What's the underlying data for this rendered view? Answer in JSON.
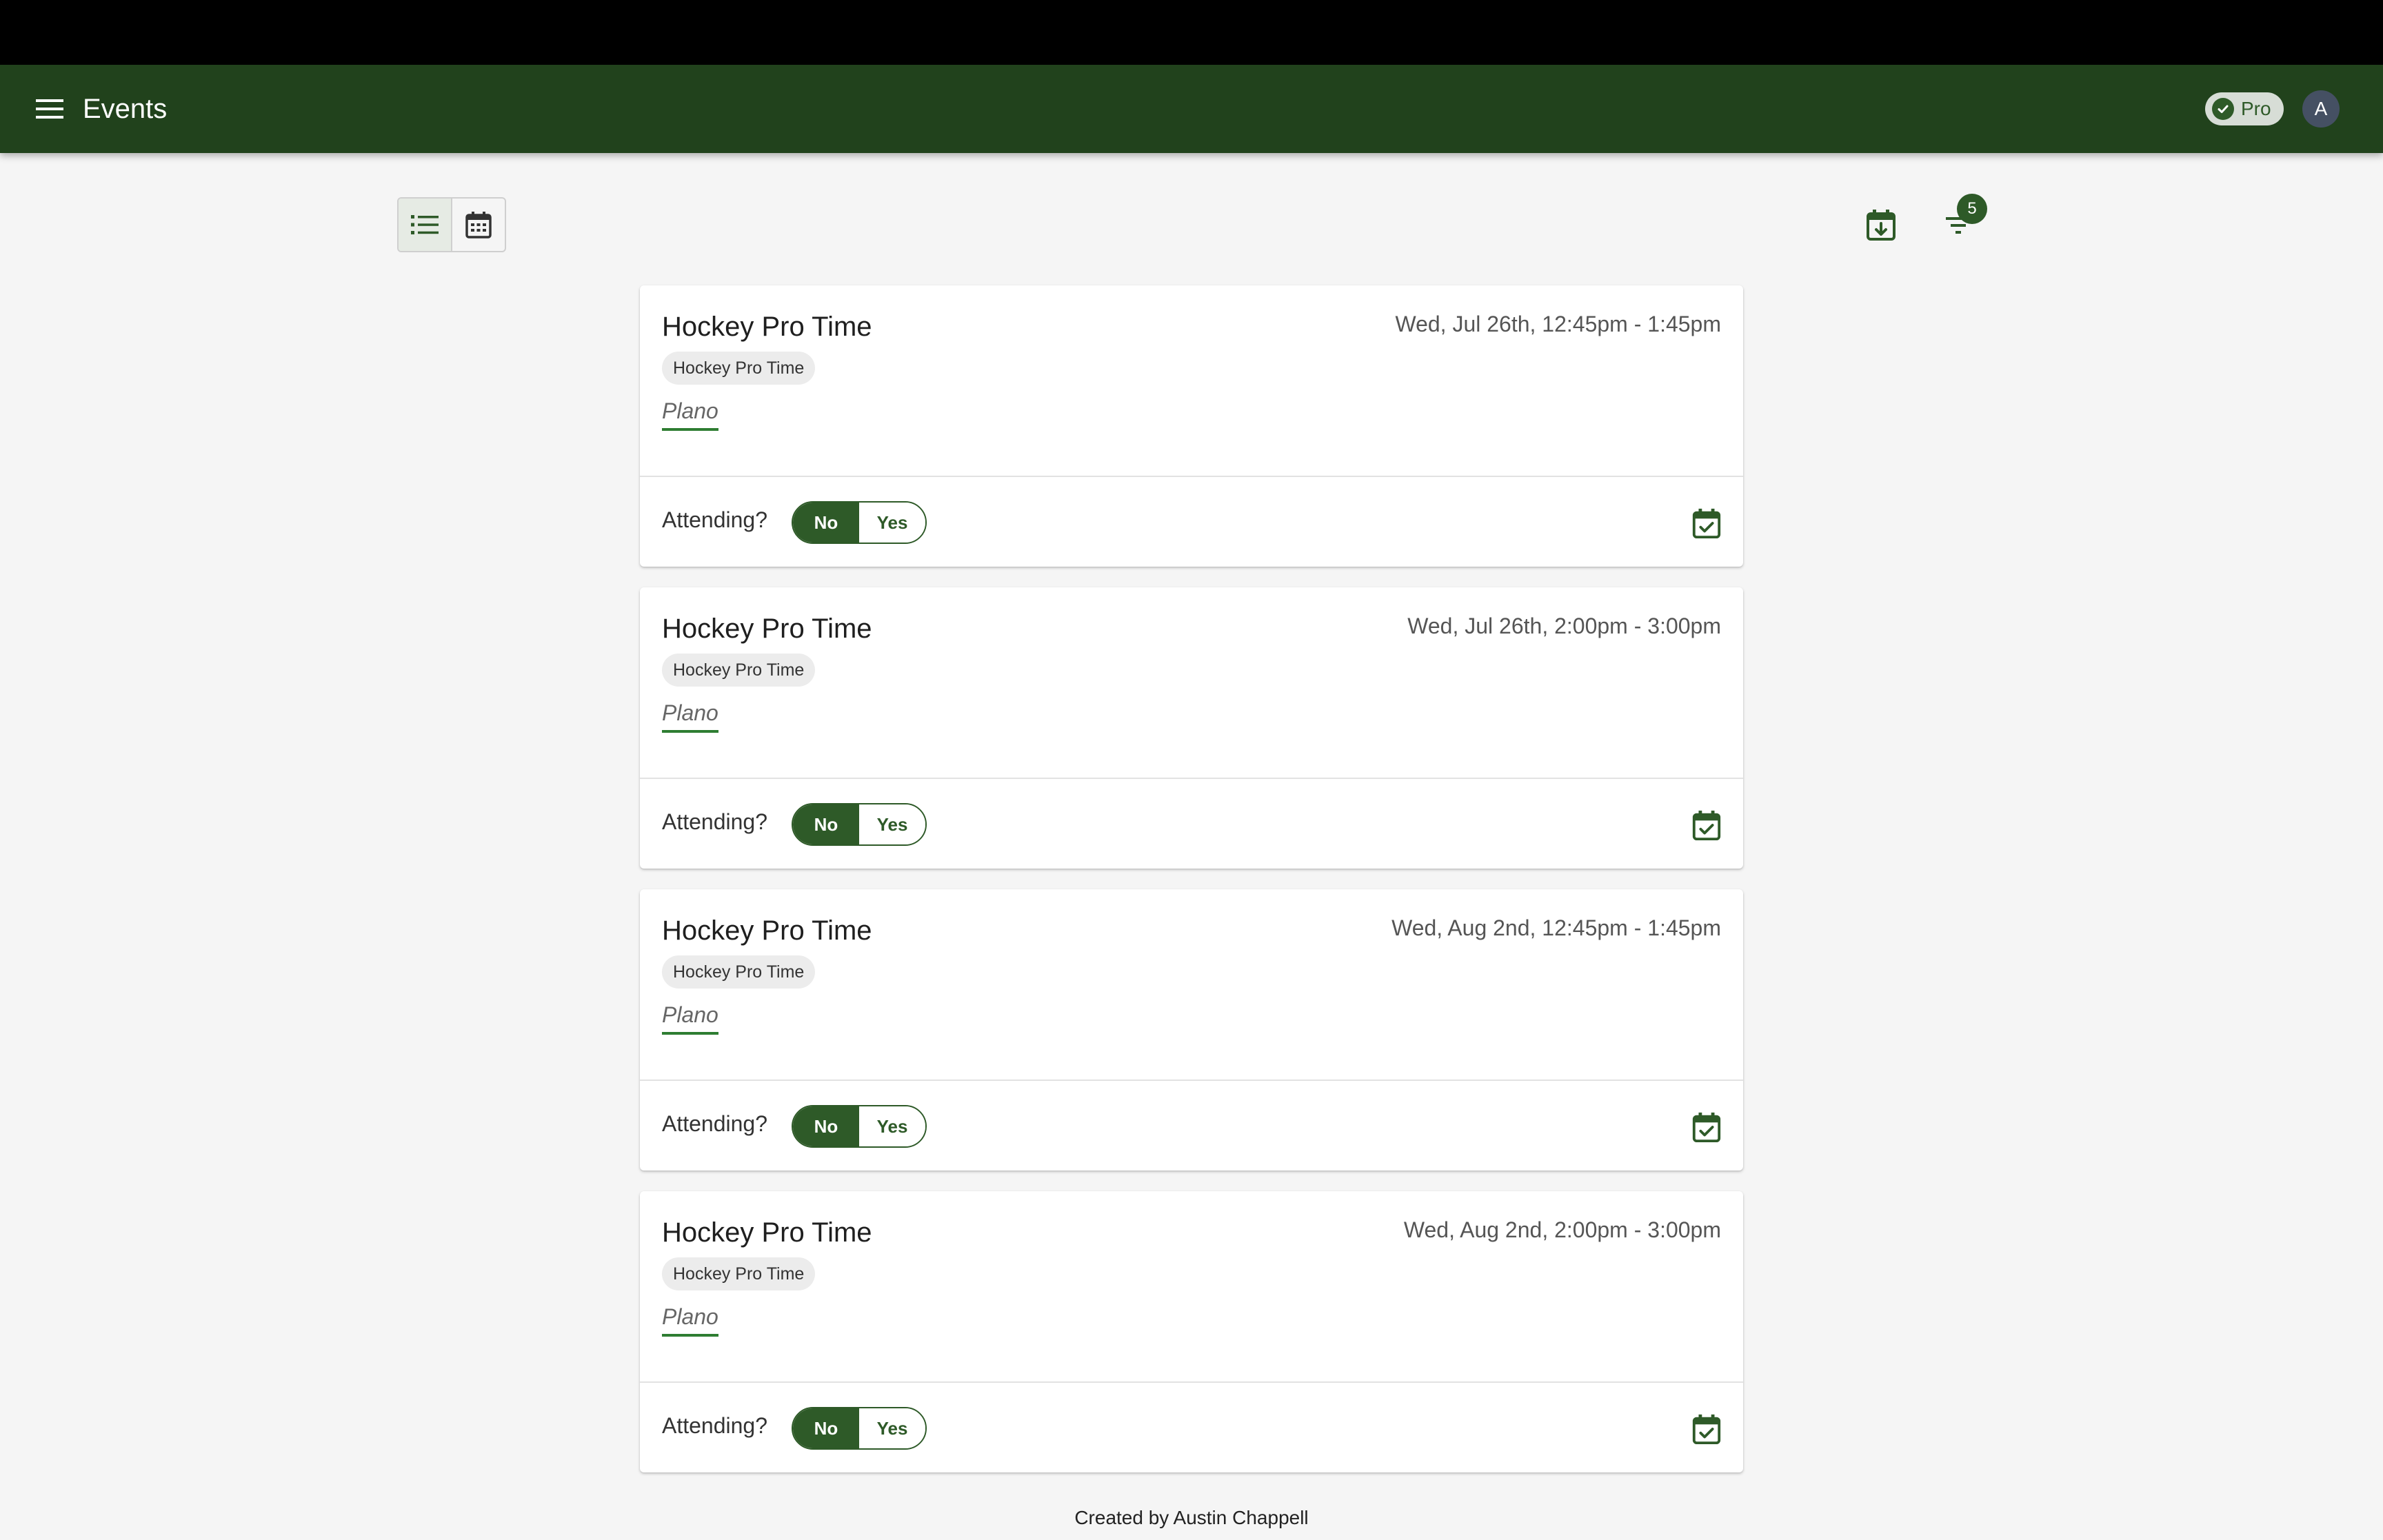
{
  "app": {
    "title": "Events",
    "pro_label": "Pro",
    "avatar_initial": "A",
    "brand_color": "#21421c",
    "accent_color": "#2e5a28"
  },
  "toolbar": {
    "view_options": [
      {
        "name": "list-view",
        "icon": "list-icon",
        "active": true
      },
      {
        "name": "calendar-view",
        "icon": "calendar-grid-icon",
        "active": false
      }
    ],
    "export_icon": "calendar-download-icon",
    "filter_icon": "filter-icon",
    "filter_count": "5"
  },
  "events": [
    {
      "title": "Hockey Pro Time",
      "time": "Wed, Jul 26th, 12:45pm - 1:45pm",
      "tag": "Hockey Pro Time",
      "location": "Plano",
      "attending_label": "Attending?",
      "no_label": "No",
      "yes_label": "Yes",
      "selected": "No"
    },
    {
      "title": "Hockey Pro Time",
      "time": "Wed, Jul 26th, 2:00pm - 3:00pm",
      "tag": "Hockey Pro Time",
      "location": "Plano",
      "attending_label": "Attending?",
      "no_label": "No",
      "yes_label": "Yes",
      "selected": "No"
    },
    {
      "title": "Hockey Pro Time",
      "time": "Wed, Aug 2nd, 12:45pm - 1:45pm",
      "tag": "Hockey Pro Time",
      "location": "Plano",
      "attending_label": "Attending?",
      "no_label": "No",
      "yes_label": "Yes",
      "selected": "No"
    },
    {
      "title": "Hockey Pro Time",
      "time": "Wed, Aug 2nd, 2:00pm - 3:00pm",
      "tag": "Hockey Pro Time",
      "location": "Plano",
      "attending_label": "Attending?",
      "no_label": "No",
      "yes_label": "Yes",
      "selected": "No"
    }
  ],
  "footer": {
    "text": "Created by Austin Chappell"
  }
}
